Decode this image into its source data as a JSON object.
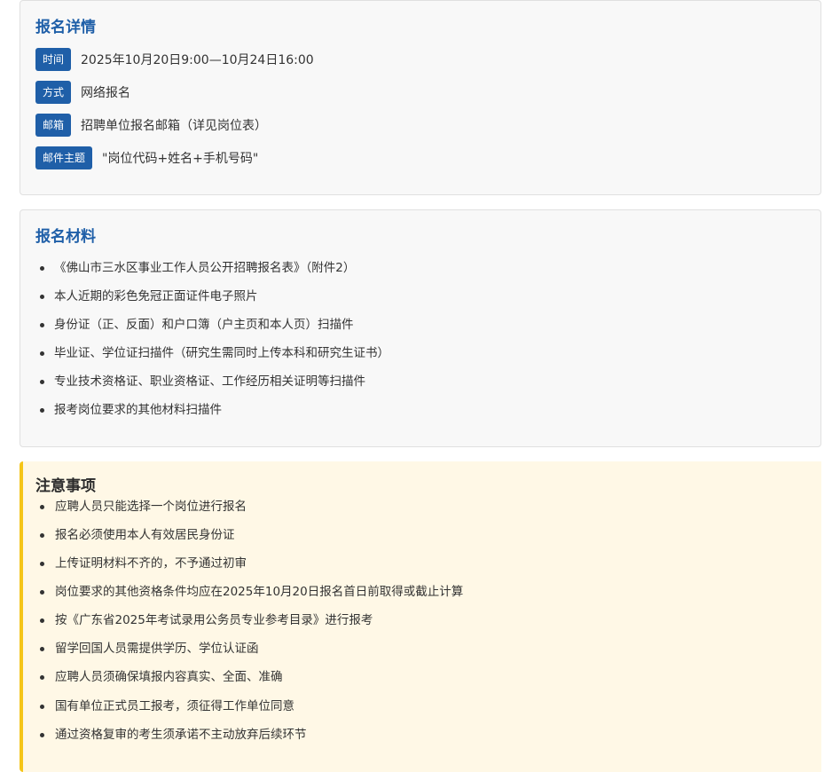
{
  "info": {
    "title": "报名详情",
    "rows": [
      {
        "tag": "时间",
        "text": "2025年10月20日9:00—10月24日16:00"
      },
      {
        "tag": "方式",
        "text": "网络报名"
      },
      {
        "tag": "邮箱",
        "text": "招聘单位报名邮箱（详见岗位表）"
      },
      {
        "tag": "邮件主题",
        "text": "\"岗位代码+姓名+手机号码\""
      }
    ]
  },
  "materials": {
    "title": "报名材料",
    "items": [
      "《佛山市三水区事业工作人员公开招聘报名表》（附件2）",
      "本人近期的彩色免冠正面证件电子照片",
      "身份证（正、反面）和户口簿（户主页和本人页）扫描件",
      "毕业证、学位证扫描件（研究生需同时上传本科和研究生证书）",
      "专业技术资格证、职业资格证、工作经历相关证明等扫描件",
      "报考岗位要求的其他材料扫描件"
    ]
  },
  "notes": {
    "title": "注意事项",
    "items": [
      "应聘人员只能选择一个岗位进行报名",
      "报名必须使用本人有效居民身份证",
      "上传证明材料不齐的，不予通过初审",
      "岗位要求的其他资格条件均应在2025年10月20日报名首日前取得或截止计算",
      "按《广东省2025年考试录用公务员专业参考目录》进行报考",
      "留学回国人员需提供学历、学位认证函",
      "应聘人员须确保填报内容真实、全面、准确",
      "国有单位正式员工报考，须征得工作单位同意",
      "通过资格复审的考生须承诺不主动放弃后续环节"
    ]
  },
  "colors": {
    "accent": "#1f5fa8",
    "notice_border": "#f5c518",
    "notice_bg": "#fff8e6"
  }
}
